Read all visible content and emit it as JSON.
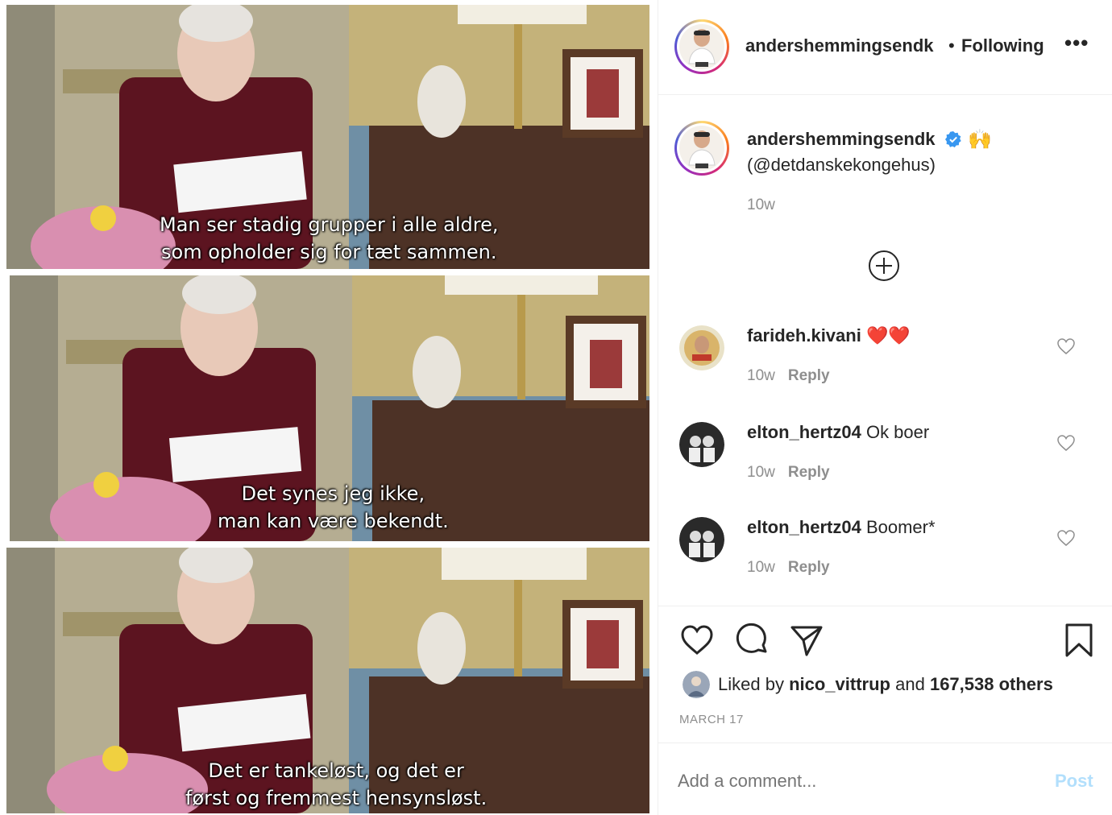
{
  "post": {
    "media": {
      "frames": [
        {
          "line1": "Man ser stadig grupper i alle aldre,",
          "line2": "som opholder sig for tæt sammen."
        },
        {
          "line1": "Det synes jeg ikke,",
          "line2": "man kan være bekendt."
        },
        {
          "line1": "Det er tankeløst, og det er",
          "line2": "først og fremmest hensynsløst."
        }
      ]
    },
    "header": {
      "username": "andershemmingsendk",
      "separator": "•",
      "follow_status": "Following",
      "more_label": "•••",
      "avatar_icon": "user-avatar-icon"
    },
    "caption": {
      "username": "andershemmingsendk",
      "emoji": "🙌",
      "text": "(@detdanskekongehus)",
      "time": "10w",
      "verified_color": "#3897f0"
    },
    "comments": [
      {
        "username": "farideh.kivani",
        "text": "",
        "emoji": "❤️❤️",
        "time": "10w",
        "reply_label": "Reply"
      },
      {
        "username": "elton_hertz04",
        "text": "Ok boer",
        "emoji": "",
        "time": "10w",
        "reply_label": "Reply"
      },
      {
        "username": "elton_hertz04",
        "text": "Boomer*",
        "emoji": "",
        "time": "10w",
        "reply_label": "Reply"
      }
    ],
    "likes": {
      "prefix": "Liked by",
      "user": "nico_vittrup",
      "middle": "and",
      "others": "167,538 others"
    },
    "date": "MARCH 17",
    "add_comment": {
      "placeholder": "Add a comment...",
      "post_label": "Post"
    },
    "colors": {
      "text": "#262626",
      "muted": "#8e8e8e",
      "post_disabled": "#b2dffc",
      "heart": "#ed4956"
    }
  }
}
